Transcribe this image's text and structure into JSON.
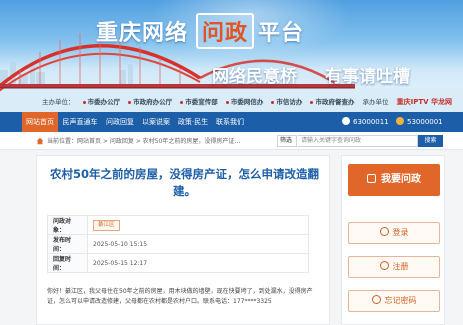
{
  "banner": {
    "title_part1": "重庆网络",
    "title_box": "问政",
    "title_part3": "平台",
    "slogan_left": "网络民意桥",
    "slogan_right": "有事请吐槽"
  },
  "sponsors": {
    "items": [
      "主办单位：",
      "市委办公厅",
      "市政府办公厅",
      "市委宣传部",
      "市委网信办",
      "市信访办",
      "市政府督查办"
    ],
    "operator": "承办单位",
    "cctv": "重庆IPTV 华龙网"
  },
  "nav": {
    "items": [
      "网站首页",
      "民声直通车",
      "问政回复",
      "以案说案",
      "政策·民生",
      "联系我们"
    ],
    "stat1": "63000011",
    "stat2": "53000001"
  },
  "crumb": {
    "text": "当前位置：网站首页 > 问政回复 > 农村50年之前的房屋，没得房产证…"
  },
  "search": {
    "filter": "筛选",
    "placeholder": "请输入关键字查询问政",
    "button": "搜索"
  },
  "article": {
    "title": "农村50年之前的房屋，没得房产证，怎么申请改造翻建。",
    "labels": {
      "target": "问政对象：",
      "post_time": "发布时间：",
      "reply_time": "回复时间："
    },
    "target": "綦江区",
    "post_time": "2025-05-10  15:15",
    "reply_time": "2025-05-15  12:17",
    "body": "你好！綦江区，我父母住在50年之前的房屋，用木块做的墙壁，现在快要垮了，到处漏水，没得房产证，怎么可以申请改造修建，父母都在农村都是农村户口。联系电话：177****3325"
  },
  "side": {
    "ask": "我要问政",
    "login": "登录",
    "register": "注册",
    "forgot": "忘记密码"
  },
  "colors": {
    "nav_blue": "#1d5ea8",
    "accent_orange": "#e0662a"
  }
}
